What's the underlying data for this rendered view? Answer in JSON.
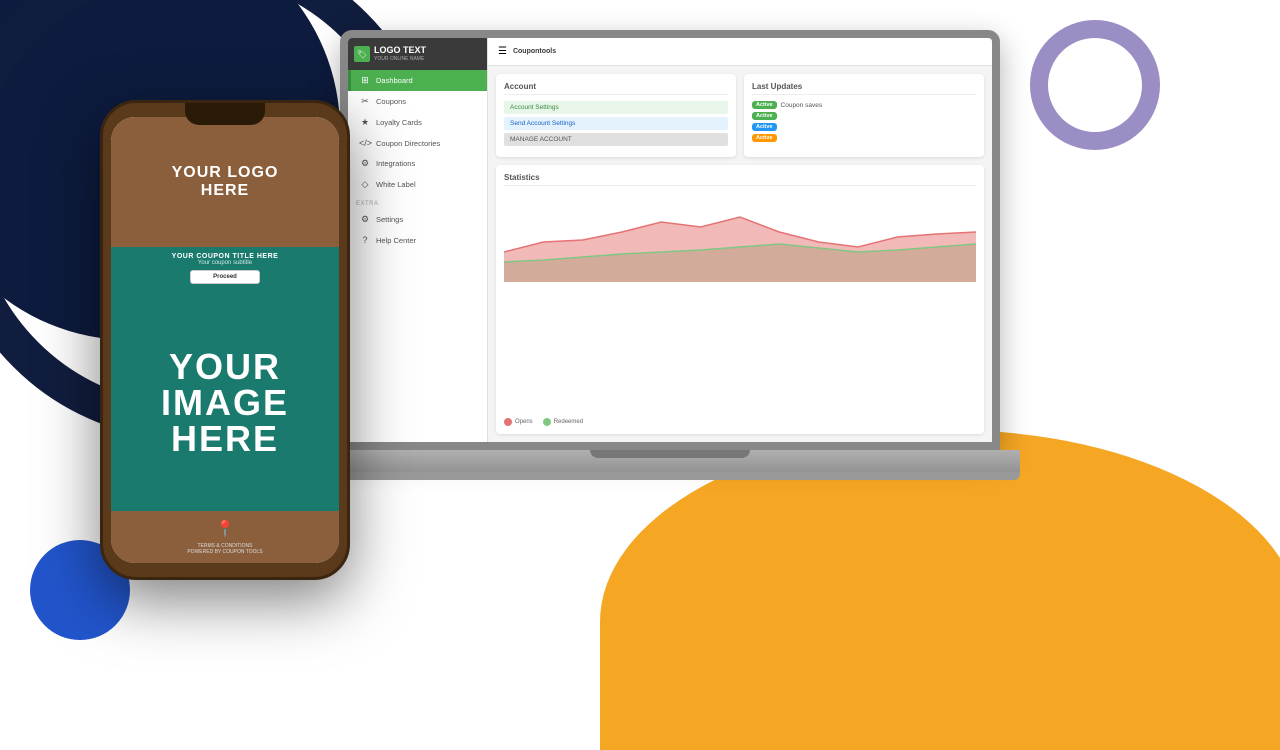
{
  "background": {
    "colors": {
      "navy": "#0d1b3e",
      "orange": "#f5a623",
      "purple_ring": "#9b8ec4",
      "blue": "#2255cc"
    }
  },
  "phone": {
    "logo_line1": "YOUR LOGO",
    "logo_line2": "HERE",
    "coupon_title": "YOUR COUPON TITLE HERE",
    "coupon_subtitle": "Your coupon subtitle",
    "proceed_label": "Proceed",
    "image_line1": "YOUR",
    "image_line2": "IMAGE",
    "image_line3": "HERE",
    "terms": "TERMS & CONDITIONS",
    "powered": "POWERED BY COUPON TOOLS"
  },
  "sidebar": {
    "logo_text": "LOGO TEXT",
    "logo_sub": "YOUR ONLINE NAME",
    "nav_items": [
      {
        "label": "Dashboard",
        "icon": "⊞",
        "active": true
      },
      {
        "label": "Coupons",
        "icon": "✂",
        "active": false,
        "badge": ""
      },
      {
        "label": "Loyalty Cards",
        "icon": "★",
        "active": false
      },
      {
        "label": "Coupon Directories",
        "icon": "</>",
        "active": false
      },
      {
        "label": "Integrations",
        "icon": "⚙",
        "active": false
      },
      {
        "label": "White Label",
        "icon": "◇",
        "active": false
      }
    ],
    "extra_label": "Extra",
    "extra_items": [
      {
        "label": "Settings",
        "icon": "⚙",
        "active": false
      },
      {
        "label": "Help Center",
        "icon": "?",
        "active": false
      }
    ]
  },
  "main": {
    "header_text": "Coupontools",
    "account_card": {
      "title": "Account",
      "buttons": [
        {
          "label": "Account Settings",
          "type": "green"
        },
        {
          "label": "Send Account Settings",
          "type": "blue"
        },
        {
          "label": "MANAGE ACCOUNT",
          "type": "default"
        }
      ]
    },
    "last_updates": {
      "title": "Last Updates",
      "items": [
        {
          "label": "Coupon saves",
          "badge": "Active",
          "badge_type": "green"
        },
        {
          "label": "",
          "badge": "Active",
          "badge_type": "green"
        },
        {
          "label": "",
          "badge": "Active",
          "badge_type": "blue"
        },
        {
          "label": "",
          "badge": "Active",
          "badge_type": "orange"
        }
      ]
    },
    "chart": {
      "title": "Statistics",
      "legend_opens": "Opens",
      "legend_redeemed": "Redeemed",
      "colors": {
        "opens": "#e57373",
        "redeemed": "#81c784"
      }
    }
  }
}
